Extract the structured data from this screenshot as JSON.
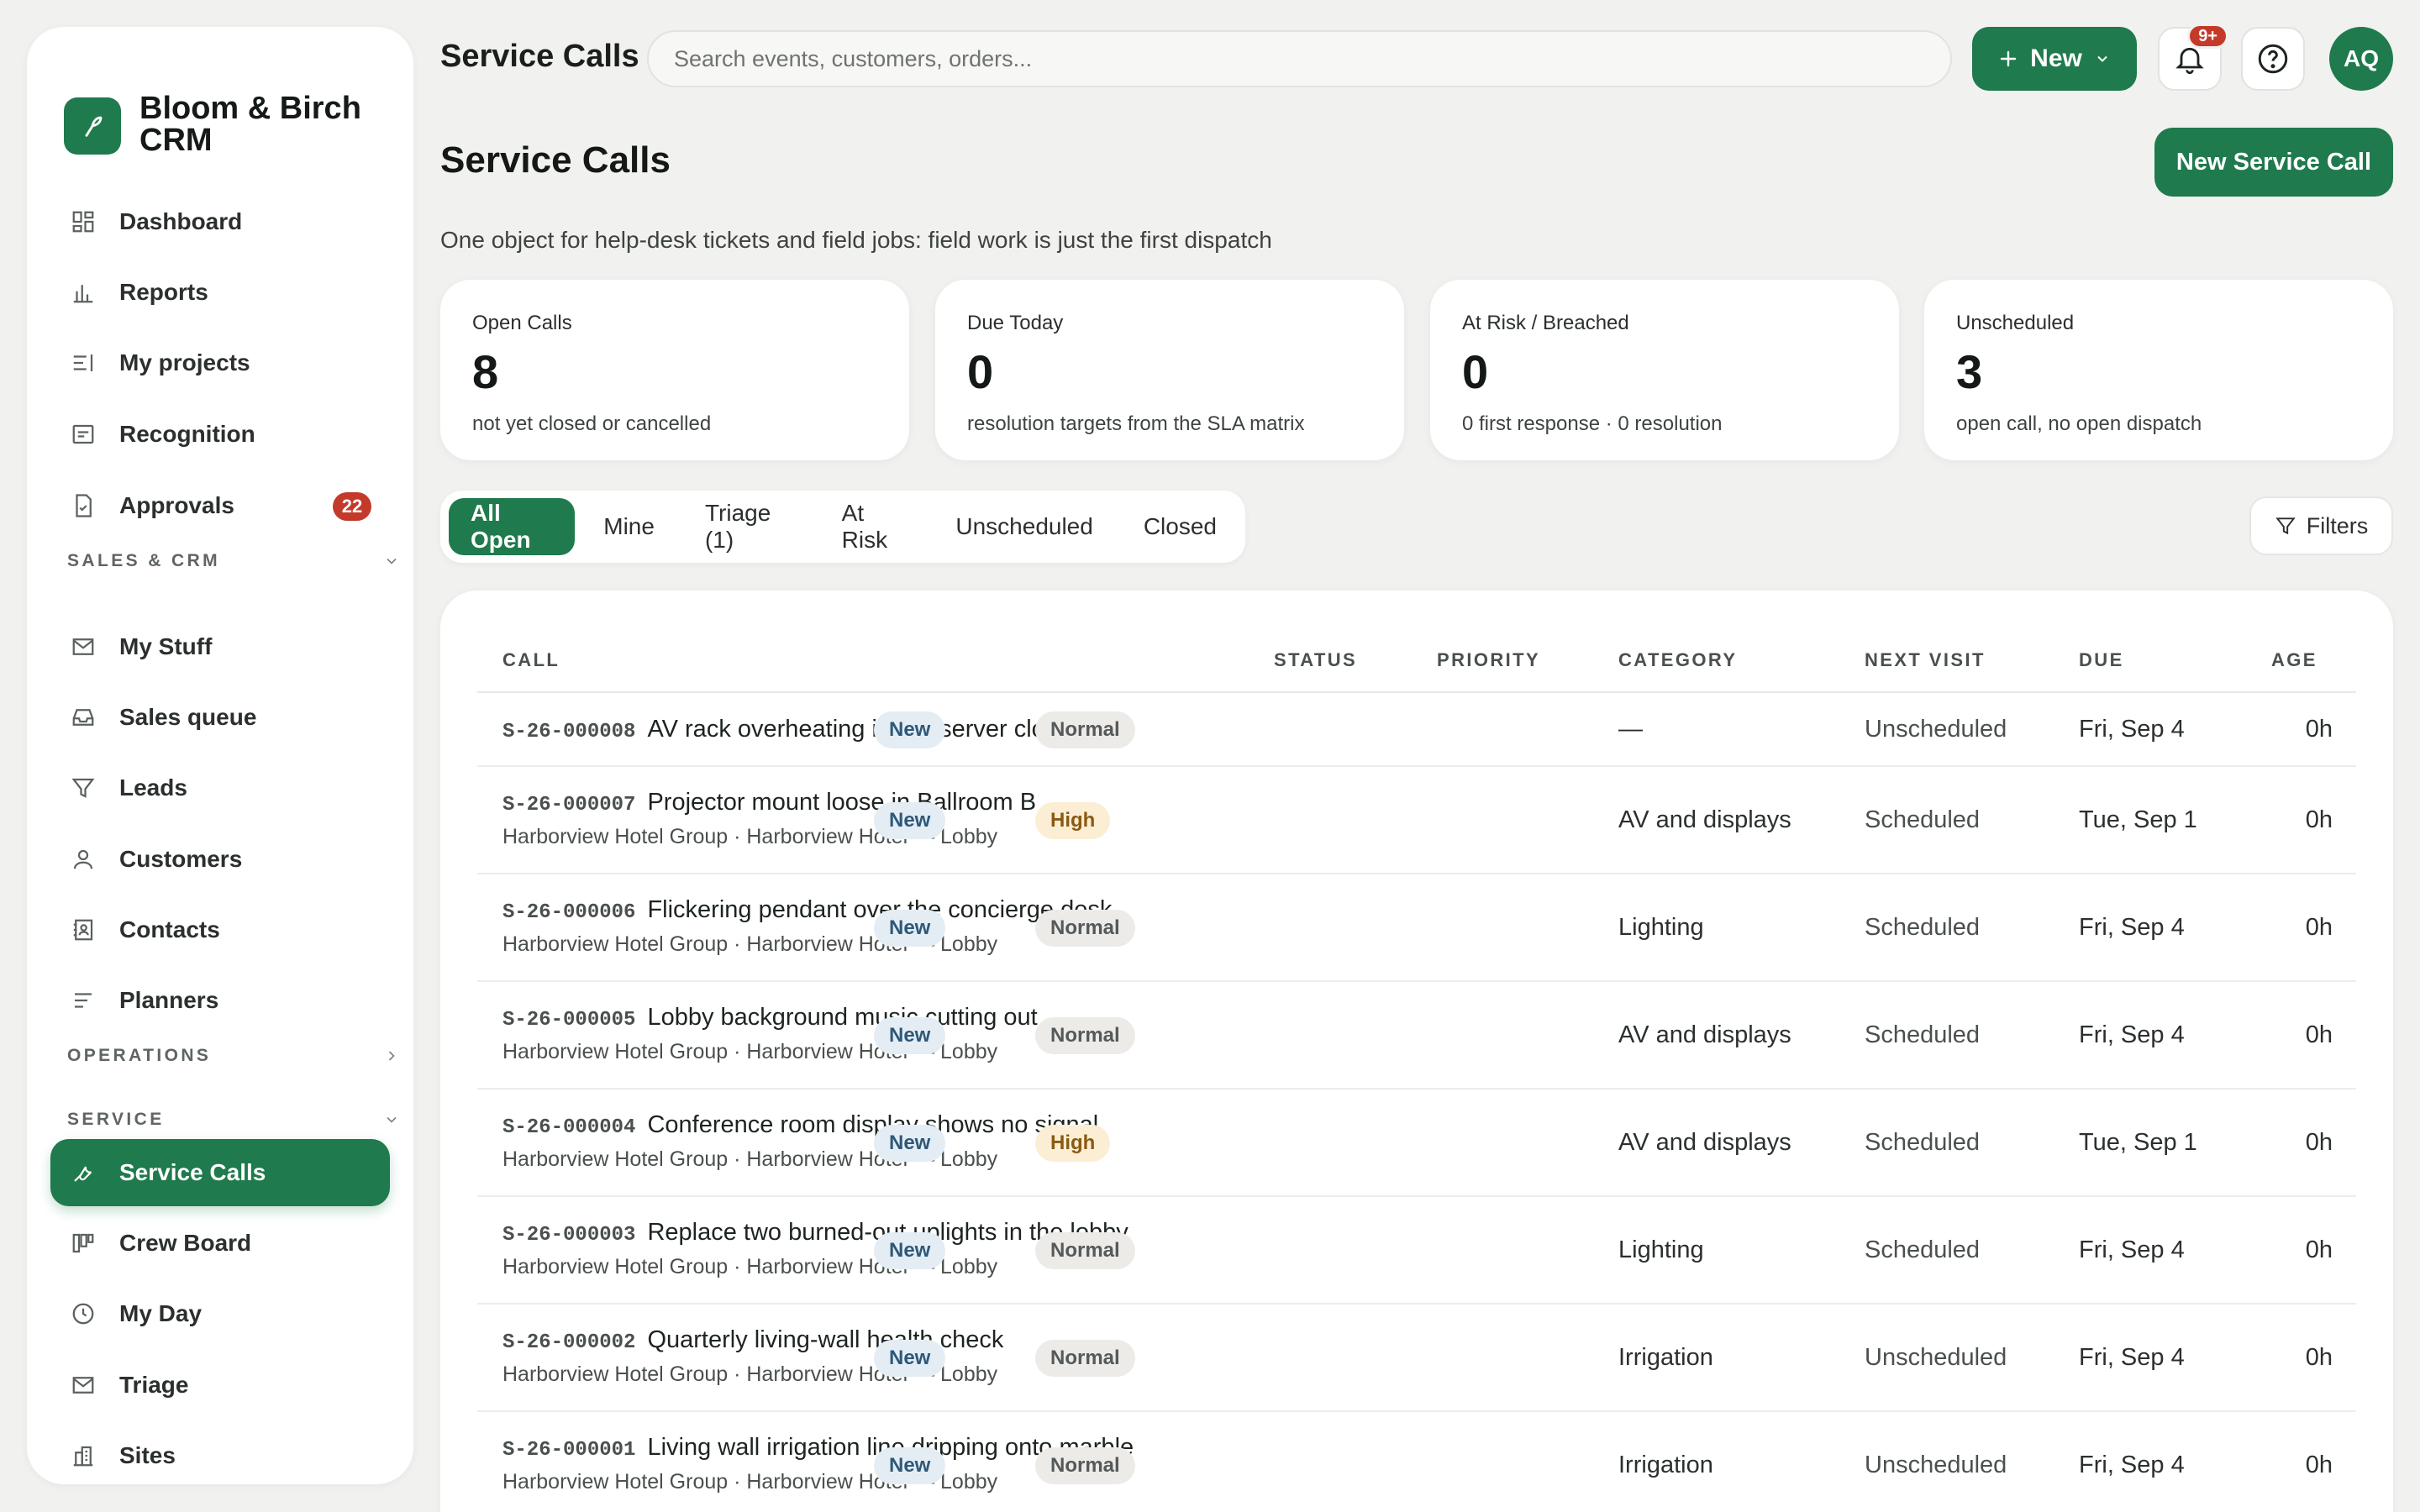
{
  "brand": {
    "name": "Bloom & Birch CRM"
  },
  "nav": {
    "dashboard": "Dashboard",
    "reports": "Reports",
    "my_projects": "My projects",
    "recognition": "Recognition",
    "approvals": "Approvals",
    "approvals_count": "22",
    "section_sales": "SALES & CRM",
    "my_stuff": "My Stuff",
    "sales_queue": "Sales queue",
    "leads": "Leads",
    "customers": "Customers",
    "contacts": "Contacts",
    "planners": "Planners",
    "section_operations": "OPERATIONS",
    "section_service": "SERVICE",
    "service_calls": "Service Calls",
    "crew_board": "Crew Board",
    "my_day": "My Day",
    "triage": "Triage",
    "sites": "Sites"
  },
  "topbar": {
    "title": "Service Calls",
    "search_placeholder": "Search events, customers, orders...",
    "new_label": "New",
    "notif_badge": "9+",
    "avatar_initials": "AQ"
  },
  "page": {
    "title": "Service Calls",
    "primary_action": "New Service Call",
    "subtitle": "One object for help-desk tickets and field jobs: field work is just the first dispatch"
  },
  "kpis": [
    {
      "label": "Open Calls",
      "value": "8",
      "sub": "not yet closed or cancelled"
    },
    {
      "label": "Due Today",
      "value": "0",
      "sub": "resolution targets from the SLA matrix"
    },
    {
      "label": "At Risk / Breached",
      "value": "0",
      "sub": "0 first response · 0 resolution"
    },
    {
      "label": "Unscheduled",
      "value": "3",
      "sub": "open call, no open dispatch"
    }
  ],
  "tabs": [
    "All Open",
    "Mine",
    "Triage (1)",
    "At Risk",
    "Unscheduled",
    "Closed"
  ],
  "filters_label": "Filters",
  "table": {
    "headers": {
      "call": "CALL",
      "status": "STATUS",
      "priority": "PRIORITY",
      "category": "CATEGORY",
      "next_visit": "NEXT VISIT",
      "due": "DUE",
      "age": "AGE"
    },
    "rows": [
      {
        "id": "S-26-000008",
        "title": "AV rack overheating in our server closet",
        "sub": "",
        "status": "New",
        "priority": "Normal",
        "category": "—",
        "next_visit": "Unscheduled",
        "due": "Fri, Sep 4",
        "age": "0h"
      },
      {
        "id": "S-26-000007",
        "title": "Projector mount loose in Ballroom B",
        "sub": "Harborview Hotel Group · Harborview Hotel — Lobby",
        "status": "New",
        "priority": "High",
        "category": "AV and displays",
        "next_visit": "Scheduled",
        "due": "Tue, Sep 1",
        "age": "0h"
      },
      {
        "id": "S-26-000006",
        "title": "Flickering pendant over the concierge desk",
        "sub": "Harborview Hotel Group · Harborview Hotel — Lobby",
        "status": "New",
        "priority": "Normal",
        "category": "Lighting",
        "next_visit": "Scheduled",
        "due": "Fri, Sep 4",
        "age": "0h"
      },
      {
        "id": "S-26-000005",
        "title": "Lobby background music cutting out",
        "sub": "Harborview Hotel Group · Harborview Hotel — Lobby",
        "status": "New",
        "priority": "Normal",
        "category": "AV and displays",
        "next_visit": "Scheduled",
        "due": "Fri, Sep 4",
        "age": "0h"
      },
      {
        "id": "S-26-000004",
        "title": "Conference room display shows no signal",
        "sub": "Harborview Hotel Group · Harborview Hotel — Lobby",
        "status": "New",
        "priority": "High",
        "category": "AV and displays",
        "next_visit": "Scheduled",
        "due": "Tue, Sep 1",
        "age": "0h"
      },
      {
        "id": "S-26-000003",
        "title": "Replace two burned-out uplights in the lobby",
        "sub": "Harborview Hotel Group · Harborview Hotel — Lobby",
        "status": "New",
        "priority": "Normal",
        "category": "Lighting",
        "next_visit": "Scheduled",
        "due": "Fri, Sep 4",
        "age": "0h"
      },
      {
        "id": "S-26-000002",
        "title": "Quarterly living-wall health check",
        "sub": "Harborview Hotel Group · Harborview Hotel — Lobby",
        "status": "New",
        "priority": "Normal",
        "category": "Irrigation",
        "next_visit": "Unscheduled",
        "due": "Fri, Sep 4",
        "age": "0h"
      },
      {
        "id": "S-26-000001",
        "title": "Living wall irrigation line dripping onto marble",
        "sub": "Harborview Hotel Group · Harborview Hotel — Lobby",
        "status": "New",
        "priority": "Normal",
        "category": "Irrigation",
        "next_visit": "Unscheduled",
        "due": "Fri, Sep 4",
        "age": "0h"
      }
    ]
  },
  "colors": {
    "accent": "#1f7a4d",
    "danger": "#c43a2a",
    "background": "#f1f1ef"
  }
}
